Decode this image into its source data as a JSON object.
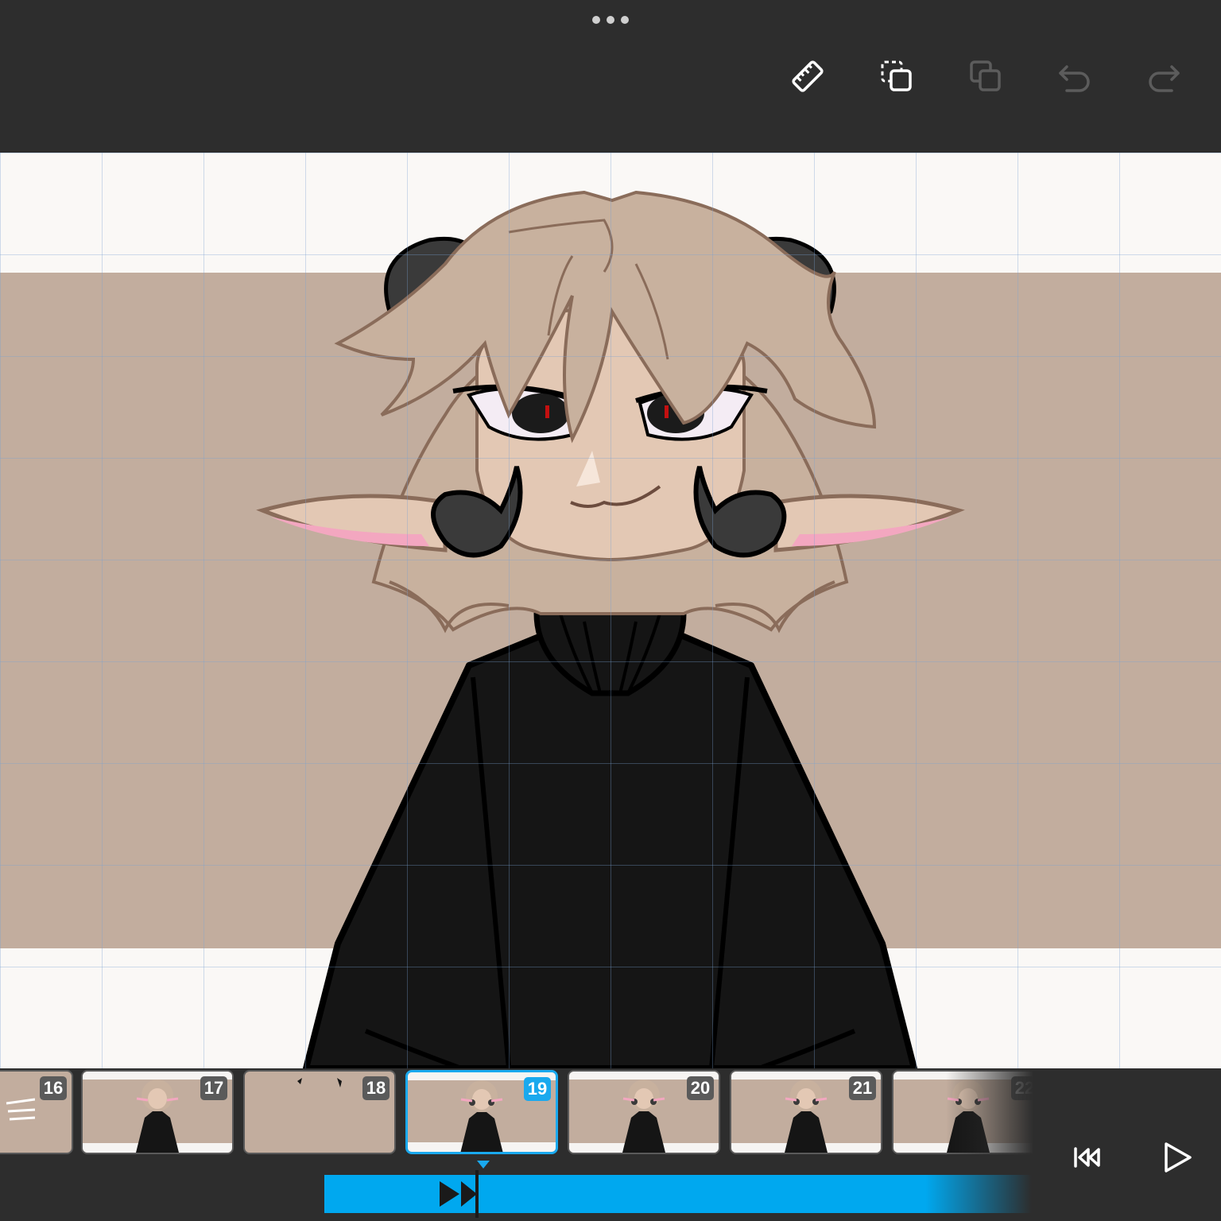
{
  "toolbar": {
    "icons": [
      "ruler-icon",
      "select-copy-icon",
      "duplicate-icon",
      "undo-icon",
      "redo-icon"
    ]
  },
  "canvas": {
    "background_color": "#faf8f6",
    "band_color": "#c2ad9e",
    "grid_color": "#7aa0d2"
  },
  "timeline": {
    "frames": [
      {
        "number": "16",
        "active": false
      },
      {
        "number": "17",
        "active": false
      },
      {
        "number": "18",
        "active": false
      },
      {
        "number": "19",
        "active": true
      },
      {
        "number": "20",
        "active": false
      },
      {
        "number": "21",
        "active": false
      },
      {
        "number": "22",
        "active": false
      }
    ],
    "accent_color": "#1aa9ee",
    "controls": [
      "rewind-to-start-icon",
      "play-icon"
    ]
  }
}
